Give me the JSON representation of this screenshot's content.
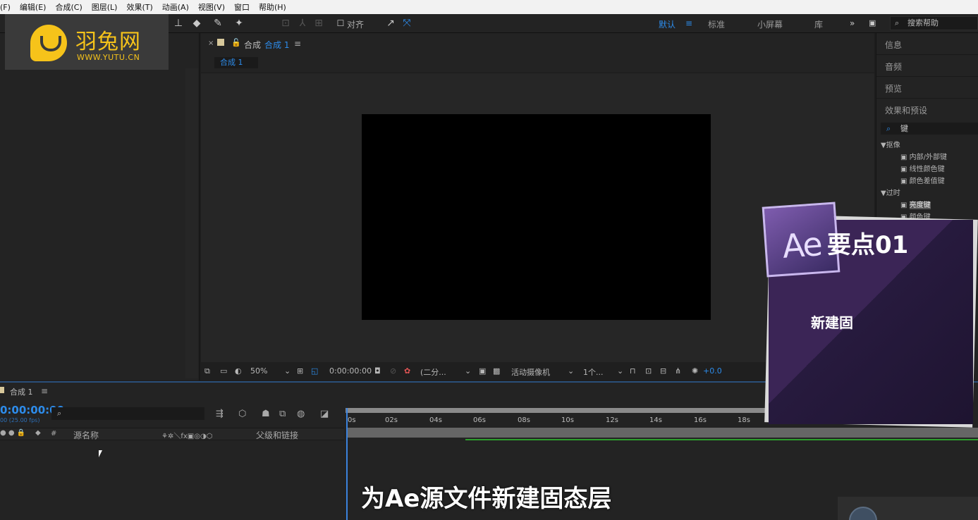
{
  "menu": {
    "items": [
      "(F)",
      "编辑(E)",
      "合成(C)",
      "图层(L)",
      "效果(T)",
      "动画(A)",
      "视图(V)",
      "窗口",
      "帮助(H)"
    ]
  },
  "toolbar": {
    "align_label": "对齐",
    "workspaces": [
      {
        "label": "默认",
        "active": true
      },
      {
        "label": "标准",
        "active": false
      },
      {
        "label": "小屏幕",
        "active": false
      },
      {
        "label": "库",
        "active": false
      }
    ],
    "more_label": "»",
    "search_help_placeholder": "搜索帮助"
  },
  "logo": {
    "cn": "羽兔网",
    "en": "WWW.YUTU.CN"
  },
  "comp_panel": {
    "header_prefix": "合成",
    "header_name": "合成 1",
    "tab_label": "合成 1",
    "footer": {
      "zoom": "50%",
      "timecode": "0:00:00:00",
      "resolution": "(二分...",
      "camera": "活动摄像机",
      "views": "1个...",
      "exposure": "+0.0"
    }
  },
  "right_panel": {
    "sections": [
      "信息",
      "音频",
      "预览",
      "效果和预设"
    ],
    "search_value": "键",
    "tree": [
      {
        "label": "▼抠像",
        "level": 0
      },
      {
        "label": "内部/外部键",
        "level": 1
      },
      {
        "label": "线性颜色键",
        "level": 1
      },
      {
        "label": "颜色差值键",
        "level": 1
      },
      {
        "label": "▼过时",
        "level": 0
      },
      {
        "label": "亮度键",
        "level": 1,
        "selected": true
      },
      {
        "label": "颜色键",
        "level": 1
      }
    ]
  },
  "timeline": {
    "tab_label": "合成 1",
    "timecode": "0:00:00:00",
    "fps": "00 (25.00 fps)",
    "col_source": "源名称",
    "col_parent": "父级和链接",
    "ticks": [
      "0s",
      "02s",
      "04s",
      "06s",
      "08s",
      "10s",
      "12s",
      "14s",
      "16s",
      "18s"
    ]
  },
  "overlay": {
    "card_title": "要点01",
    "card_ae": "Ae",
    "card_sub": "新建固",
    "subtitle": "为Ae源文件新建固态层"
  },
  "colors": {
    "accent": "#2d8ceb",
    "brand_yellow": "#f6c31a",
    "card_purple": "#3b2556"
  }
}
